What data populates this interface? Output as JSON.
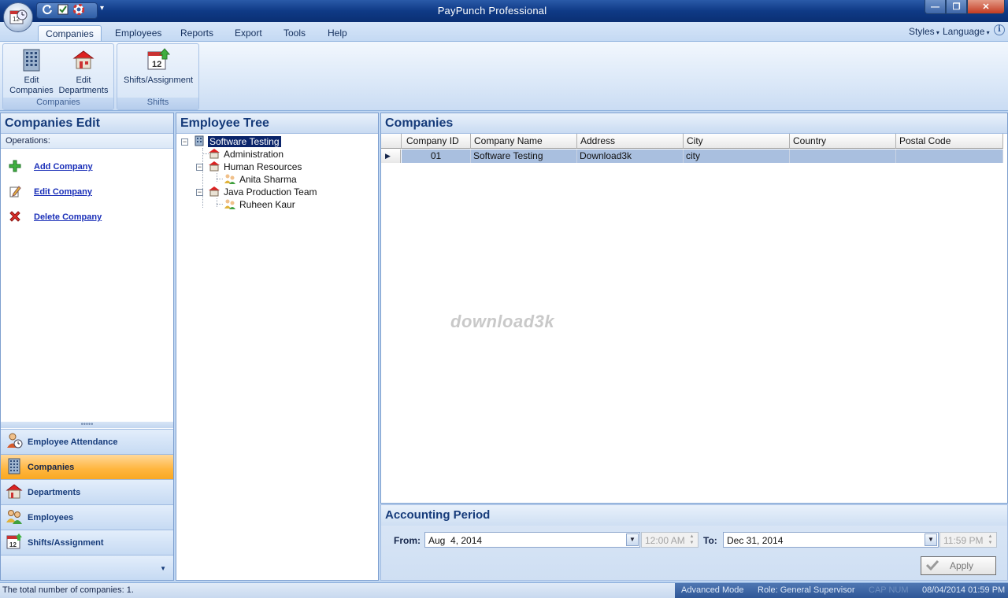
{
  "window": {
    "title": "PayPunch Professional"
  },
  "ribbon": {
    "tabs": [
      "Companies",
      "Employees",
      "Reports",
      "Export",
      "Tools",
      "Help"
    ],
    "right_menus": {
      "styles": "Styles",
      "language": "Language"
    },
    "groups": {
      "companies": {
        "label": "Companies",
        "buttons": {
          "edit_companies": [
            "Edit",
            "Companies"
          ],
          "edit_departments": [
            "Edit",
            "Departments"
          ]
        }
      },
      "shifts": {
        "label": "Shifts",
        "buttons": {
          "shifts_assignment": "Shifts/Assignment"
        }
      }
    }
  },
  "left_panel": {
    "title": "Companies Edit",
    "operations_label": "Operations:",
    "operations": [
      "Add Company",
      "Edit Company",
      "Delete Company"
    ],
    "nav": [
      "Employee Attendance",
      "Companies",
      "Departments",
      "Employees",
      "Shifts/Assignment"
    ],
    "active_nav": "Companies"
  },
  "tree_panel": {
    "title": "Employee Tree",
    "nodes": {
      "root": "Software Testing",
      "administration": "Administration",
      "human_resources": "Human Resources",
      "anita": "Anita Sharma",
      "java_team": "Java Production Team",
      "ruheen": "Ruheen Kaur"
    }
  },
  "grid_panel": {
    "title": "Companies",
    "columns": [
      "Company ID",
      "Company Name",
      "Address",
      "City",
      "Country",
      "Postal Code"
    ],
    "rows": [
      {
        "id": "01",
        "name": "Software Testing",
        "address": "Download3k",
        "city": "city",
        "country": "",
        "postal_code": ""
      }
    ],
    "watermark": "download3k"
  },
  "accounting_period": {
    "title": "Accounting Period",
    "from_label": "From:",
    "from_date": "Aug  4, 2014",
    "from_time": "12:00 AM",
    "to_label": "To:",
    "to_date": "Dec 31, 2014",
    "to_time": "11:59 PM",
    "apply_label": "Apply"
  },
  "status_bar": {
    "text": "The total number of companies: 1.",
    "mode": "Advanced Mode",
    "role": "Role: General Supervisor",
    "faded": "CAP  NUM",
    "datetime": "08/04/2014 01:59 PM"
  },
  "colors": {
    "accent_orange": "#ffb53d",
    "title_blue": "#0f3a86",
    "link_blue": "#1a2fb8"
  }
}
